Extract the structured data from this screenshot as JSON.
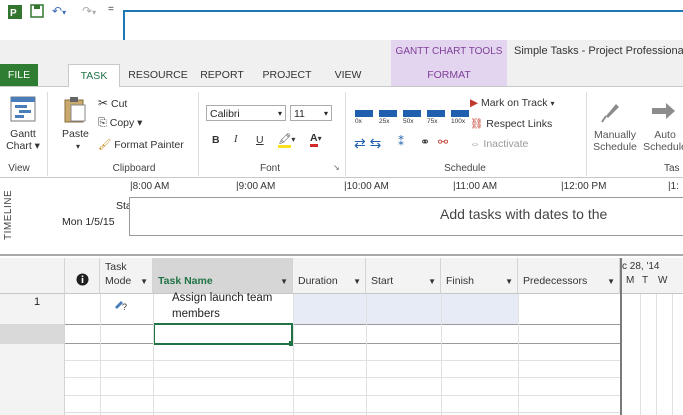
{
  "quick_access": {
    "app_icon": "project-app-icon",
    "save_icon": "save-icon",
    "undo_icon": "undo-icon",
    "redo_icon": "redo-icon",
    "customize_icon": "customize-qat-icon"
  },
  "contextual_tab": "GANTT CHART TOOLS",
  "window_title": "Simple Tasks - Project Professiona",
  "tabs": {
    "file": "FILE",
    "task": "TASK",
    "resource": "RESOURCE",
    "report": "REPORT",
    "project": "PROJECT",
    "view": "VIEW",
    "format": "FORMAT"
  },
  "ribbon": {
    "view": {
      "gantt_chart_line1": "Gantt",
      "gantt_chart_line2": "Chart ▾",
      "group_label": "View"
    },
    "clipboard": {
      "paste": "Paste",
      "cut": "Cut",
      "copy": "Copy ▾",
      "format_painter": "Format Painter",
      "group_label": "Clipboard"
    },
    "font": {
      "font_name": "Calibri",
      "font_size": "11",
      "bold": "B",
      "italic": "I",
      "underline": "U",
      "group_label": "Font"
    },
    "schedule": {
      "pct_labels": [
        "0x",
        "25x",
        "50x",
        "75x",
        "100x"
      ],
      "mark_on_track": "Mark on Track",
      "respect_links": "Respect Links",
      "inactivate": "Inactivate",
      "group_label": "Schedule"
    },
    "tasks": {
      "manually_schedule_line1": "Manually",
      "manually_schedule_line2": "Schedule",
      "auto_schedule_line1": "Auto",
      "auto_schedule_line2": "Schedule",
      "group_label": "Tas"
    }
  },
  "timeline": {
    "label": "TIMELINE",
    "start_label": "Start",
    "start_date": "Mon 1/5/15",
    "ticks": [
      "8:00 AM",
      "9:00 AM",
      "10:00 AM",
      "11:00 AM",
      "12:00 PM",
      "1:"
    ],
    "placeholder": "Add tasks with dates to the"
  },
  "grid": {
    "columns": {
      "info_icon": "info-icon",
      "task_mode_line1": "Task",
      "task_mode_line2": "Mode",
      "task_name": "Task Name",
      "duration": "Duration",
      "start": "Start",
      "finish": "Finish",
      "predecessors": "Predecessors"
    },
    "rows": [
      {
        "id": "1",
        "mode_icon": "manually-scheduled-task-icon",
        "name_line1": "Assign launch team",
        "name_line2": "members"
      }
    ],
    "gantt_header": {
      "week": "c 28, '14",
      "days": [
        "M",
        "T",
        "W"
      ]
    }
  },
  "colors": {
    "accent_green": "#217346",
    "contextual_purple": "#7f3f98",
    "callout_blue": "#1f77b4"
  }
}
